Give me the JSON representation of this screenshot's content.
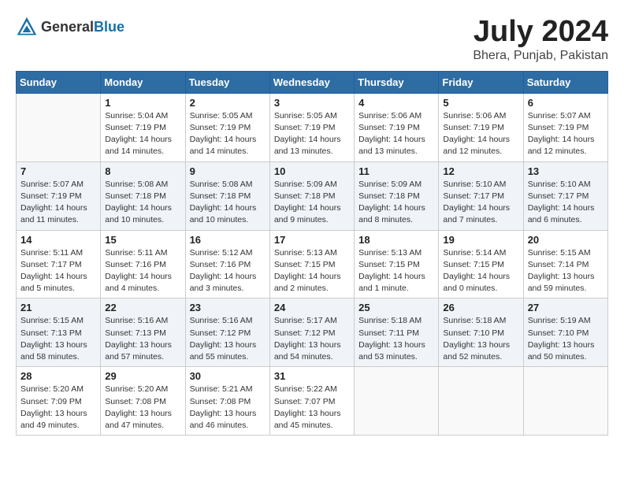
{
  "header": {
    "logo_general": "General",
    "logo_blue": "Blue",
    "title": "July 2024",
    "location": "Bhera, Punjab, Pakistan"
  },
  "weekdays": [
    "Sunday",
    "Monday",
    "Tuesday",
    "Wednesday",
    "Thursday",
    "Friday",
    "Saturday"
  ],
  "weeks": [
    [
      {
        "day": "",
        "info": ""
      },
      {
        "day": "1",
        "info": "Sunrise: 5:04 AM\nSunset: 7:19 PM\nDaylight: 14 hours\nand 14 minutes."
      },
      {
        "day": "2",
        "info": "Sunrise: 5:05 AM\nSunset: 7:19 PM\nDaylight: 14 hours\nand 14 minutes."
      },
      {
        "day": "3",
        "info": "Sunrise: 5:05 AM\nSunset: 7:19 PM\nDaylight: 14 hours\nand 13 minutes."
      },
      {
        "day": "4",
        "info": "Sunrise: 5:06 AM\nSunset: 7:19 PM\nDaylight: 14 hours\nand 13 minutes."
      },
      {
        "day": "5",
        "info": "Sunrise: 5:06 AM\nSunset: 7:19 PM\nDaylight: 14 hours\nand 12 minutes."
      },
      {
        "day": "6",
        "info": "Sunrise: 5:07 AM\nSunset: 7:19 PM\nDaylight: 14 hours\nand 12 minutes."
      }
    ],
    [
      {
        "day": "7",
        "info": "Sunrise: 5:07 AM\nSunset: 7:19 PM\nDaylight: 14 hours\nand 11 minutes."
      },
      {
        "day": "8",
        "info": "Sunrise: 5:08 AM\nSunset: 7:18 PM\nDaylight: 14 hours\nand 10 minutes."
      },
      {
        "day": "9",
        "info": "Sunrise: 5:08 AM\nSunset: 7:18 PM\nDaylight: 14 hours\nand 10 minutes."
      },
      {
        "day": "10",
        "info": "Sunrise: 5:09 AM\nSunset: 7:18 PM\nDaylight: 14 hours\nand 9 minutes."
      },
      {
        "day": "11",
        "info": "Sunrise: 5:09 AM\nSunset: 7:18 PM\nDaylight: 14 hours\nand 8 minutes."
      },
      {
        "day": "12",
        "info": "Sunrise: 5:10 AM\nSunset: 7:17 PM\nDaylight: 14 hours\nand 7 minutes."
      },
      {
        "day": "13",
        "info": "Sunrise: 5:10 AM\nSunset: 7:17 PM\nDaylight: 14 hours\nand 6 minutes."
      }
    ],
    [
      {
        "day": "14",
        "info": "Sunrise: 5:11 AM\nSunset: 7:17 PM\nDaylight: 14 hours\nand 5 minutes."
      },
      {
        "day": "15",
        "info": "Sunrise: 5:11 AM\nSunset: 7:16 PM\nDaylight: 14 hours\nand 4 minutes."
      },
      {
        "day": "16",
        "info": "Sunrise: 5:12 AM\nSunset: 7:16 PM\nDaylight: 14 hours\nand 3 minutes."
      },
      {
        "day": "17",
        "info": "Sunrise: 5:13 AM\nSunset: 7:15 PM\nDaylight: 14 hours\nand 2 minutes."
      },
      {
        "day": "18",
        "info": "Sunrise: 5:13 AM\nSunset: 7:15 PM\nDaylight: 14 hours\nand 1 minute."
      },
      {
        "day": "19",
        "info": "Sunrise: 5:14 AM\nSunset: 7:15 PM\nDaylight: 14 hours\nand 0 minutes."
      },
      {
        "day": "20",
        "info": "Sunrise: 5:15 AM\nSunset: 7:14 PM\nDaylight: 13 hours\nand 59 minutes."
      }
    ],
    [
      {
        "day": "21",
        "info": "Sunrise: 5:15 AM\nSunset: 7:13 PM\nDaylight: 13 hours\nand 58 minutes."
      },
      {
        "day": "22",
        "info": "Sunrise: 5:16 AM\nSunset: 7:13 PM\nDaylight: 13 hours\nand 57 minutes."
      },
      {
        "day": "23",
        "info": "Sunrise: 5:16 AM\nSunset: 7:12 PM\nDaylight: 13 hours\nand 55 minutes."
      },
      {
        "day": "24",
        "info": "Sunrise: 5:17 AM\nSunset: 7:12 PM\nDaylight: 13 hours\nand 54 minutes."
      },
      {
        "day": "25",
        "info": "Sunrise: 5:18 AM\nSunset: 7:11 PM\nDaylight: 13 hours\nand 53 minutes."
      },
      {
        "day": "26",
        "info": "Sunrise: 5:18 AM\nSunset: 7:10 PM\nDaylight: 13 hours\nand 52 minutes."
      },
      {
        "day": "27",
        "info": "Sunrise: 5:19 AM\nSunset: 7:10 PM\nDaylight: 13 hours\nand 50 minutes."
      }
    ],
    [
      {
        "day": "28",
        "info": "Sunrise: 5:20 AM\nSunset: 7:09 PM\nDaylight: 13 hours\nand 49 minutes."
      },
      {
        "day": "29",
        "info": "Sunrise: 5:20 AM\nSunset: 7:08 PM\nDaylight: 13 hours\nand 47 minutes."
      },
      {
        "day": "30",
        "info": "Sunrise: 5:21 AM\nSunset: 7:08 PM\nDaylight: 13 hours\nand 46 minutes."
      },
      {
        "day": "31",
        "info": "Sunrise: 5:22 AM\nSunset: 7:07 PM\nDaylight: 13 hours\nand 45 minutes."
      },
      {
        "day": "",
        "info": ""
      },
      {
        "day": "",
        "info": ""
      },
      {
        "day": "",
        "info": ""
      }
    ]
  ]
}
